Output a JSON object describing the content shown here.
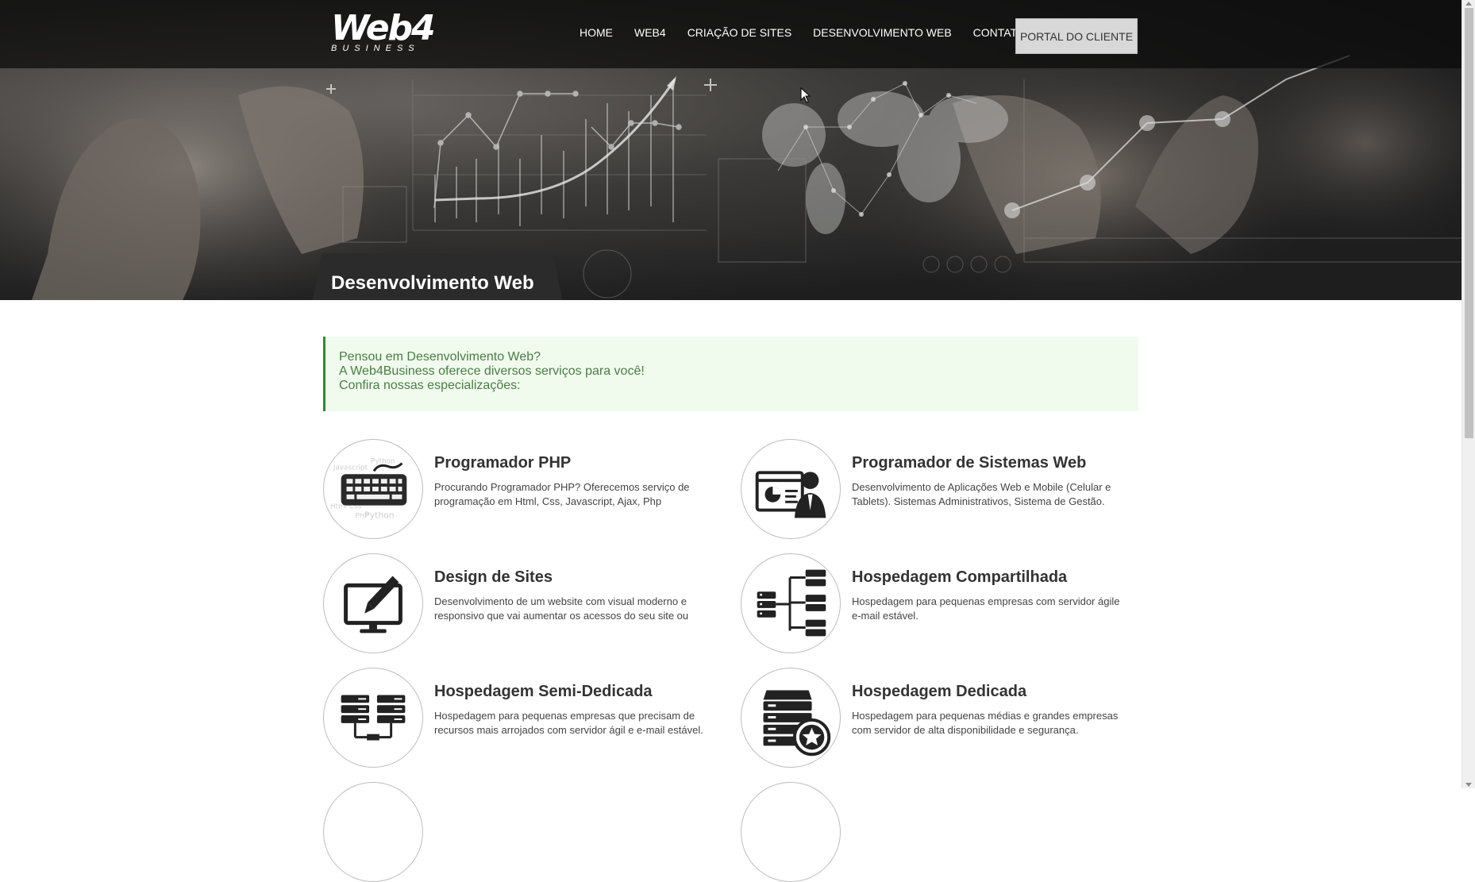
{
  "header": {
    "logo_main": "Web4",
    "logo_sub": "BUSINESS",
    "nav": [
      "HOME",
      "WEB4",
      "CRIAÇÃO DE SITES",
      "DESENVOLVIMENTO WEB",
      "CONTATO"
    ],
    "portal_button": "PORTAL DO CLIENTE"
  },
  "hero": {
    "page_title": "Desenvolvimento Web"
  },
  "intro": {
    "lines": [
      "Pensou em Desenvolvimento Web?",
      "A Web4Business oferece diversos serviços para você!",
      "Confira nossas especializações:"
    ]
  },
  "services": [
    {
      "title": "Programador PHP",
      "description": "Procurando Programador PHP? Oferecemos serviço de programação em Html, Css, Javascript, Ajax, Php",
      "icon": "keyboard-icon"
    },
    {
      "title": "Programador de Sistemas Web",
      "description": "Desenvolvimento de Aplicações Web e Mobile (Celular e Tablets). Sistemas Administrativos, Sistema de Gestão.",
      "icon": "developer-presentation-icon"
    },
    {
      "title": "Design de Sites",
      "description": "Desenvolvimento de um website com visual moderno e responsivo que vai aumentar os acessos do seu site ou",
      "icon": "monitor-pen-icon"
    },
    {
      "title": "Hospedagem Compartilhada",
      "description": "Hospedagem para pequenas empresas com servidor ágile e-mail estável.",
      "icon": "server-network-icon"
    },
    {
      "title": "Hospedagem Semi-Dedicada",
      "description": "Hospedagem para pequenas empresas que precisam de recursos mais arrojados com servidor ágil e e-mail estável.",
      "icon": "two-servers-icon"
    },
    {
      "title": "Hospedagem Dedicada",
      "description": "Hospedagem para pequenas médias e grandes empresas com servidor de alta disponibilidade e segurança.",
      "icon": "server-star-icon"
    }
  ]
}
